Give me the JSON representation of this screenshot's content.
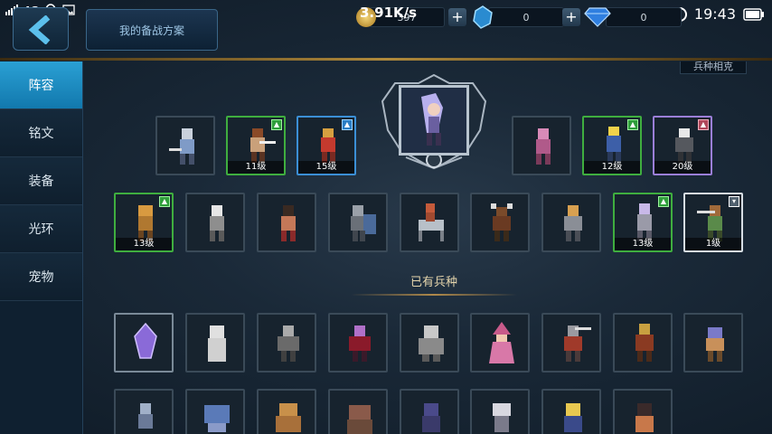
{
  "status_bar": {
    "network": "4G",
    "time": "19:43"
  },
  "header": {
    "back_icon": "back-arrow-icon",
    "plan_button": "我的备战方案",
    "gold_rate": "3.91K/s",
    "gold_value": "397",
    "crystal_value": "0",
    "diamond_value": "0"
  },
  "sidebar": {
    "items": [
      {
        "label": "阵容",
        "active": true
      },
      {
        "label": "铭文"
      },
      {
        "label": "装备"
      },
      {
        "label": "光环"
      },
      {
        "label": "宠物"
      }
    ]
  },
  "subtab_label": "兵种相克",
  "formation": {
    "leader_icon": "commander-portrait-icon",
    "front_row": [
      {
        "level": "",
        "rarity": "none"
      },
      {
        "level": "11级",
        "rarity": "green"
      },
      {
        "level": "15级",
        "rarity": "blue"
      },
      {
        "level": "",
        "rarity": "none"
      },
      {
        "level": "12级",
        "rarity": "green"
      },
      {
        "level": "20级",
        "rarity": "purple"
      }
    ],
    "back_row": [
      {
        "level": "13级",
        "rarity": "green"
      },
      {
        "level": "",
        "rarity": "none"
      },
      {
        "level": "",
        "rarity": "none"
      },
      {
        "level": "",
        "rarity": "none"
      },
      {
        "level": "",
        "rarity": "none"
      },
      {
        "level": "",
        "rarity": "none"
      },
      {
        "level": "",
        "rarity": "none"
      },
      {
        "level": "13级",
        "rarity": "green"
      },
      {
        "level": "1级",
        "rarity": "white"
      }
    ]
  },
  "owned_section_title": "已有兵种",
  "colors": {
    "accent": "#2aa0d4",
    "gold": "#b08a3c",
    "green_border": "#3fae3f",
    "blue_border": "#3b8fd6",
    "purple_border": "#9b7fd8"
  }
}
